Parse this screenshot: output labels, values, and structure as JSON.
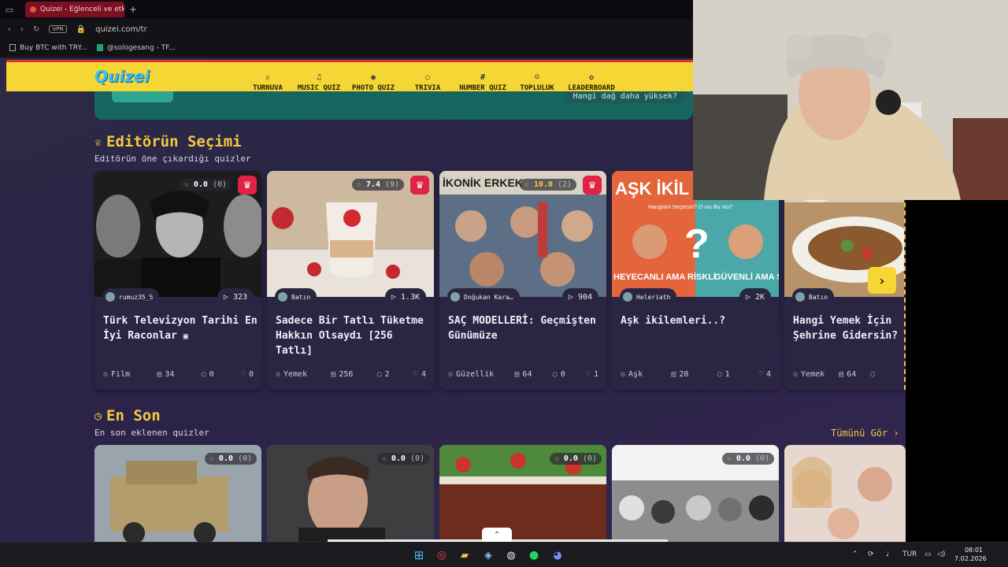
{
  "browser": {
    "tab_title": "Quizei - Eğlenceli ve etkile",
    "new_tab": "+",
    "vpn": "VPN",
    "url": "quizei.com/tr",
    "bookmarks": [
      "Buy BTC with TRY...",
      "@sologesang - TF..."
    ]
  },
  "site": {
    "logo": "Quizei",
    "nav": [
      {
        "label": "TURNUVA",
        "icon": "trophy-icon"
      },
      {
        "label": "MUSIC QUIZ",
        "icon": "music-note-icon"
      },
      {
        "label": "PHOTO QUIZ",
        "icon": "camera-icon"
      },
      {
        "label": "TRIVIA",
        "icon": "chat-icon"
      },
      {
        "label": "NUMBER QUIZ",
        "icon": "hash-icon"
      },
      {
        "label": "TOPLULUK",
        "icon": "users-icon"
      },
      {
        "label": "LEADERBOARD",
        "icon": "medal-icon"
      }
    ],
    "hero_question": "Hangi dağ daha yüksek?"
  },
  "editors_choice": {
    "title": "Editörün Seçimi",
    "subtitle": "Editörün öne çıkardığı quizler",
    "cards": [
      {
        "rating": "0.0",
        "votes": "(0)",
        "author": "rumuz35_5",
        "plays": "323",
        "title": "Türk Televizyon Tarihi En İyi Raconlar",
        "category": "Film",
        "questions": "34",
        "comments": "0",
        "likes": "0",
        "has_video": true,
        "thumb_color": "#222"
      },
      {
        "rating": "7.4",
        "votes": "(9)",
        "author": "Batın",
        "plays": "1.3K",
        "title": "Sadece Bir Tatlı Tüketme Hakkın Olsaydı [256 Tatlı]",
        "category": "Yemek",
        "questions": "256",
        "comments": "2",
        "likes": "4",
        "thumb_color": "#c9b39a"
      },
      {
        "rating": "10.0",
        "votes": "(2)",
        "author": "Doğukan Kara…",
        "plays": "904",
        "title": "SAÇ MODELLERİ: Geçmişten Günümüze",
        "category": "Güzellik",
        "questions": "64",
        "comments": "0",
        "likes": "1",
        "thumb_color": "#5b6e8a"
      },
      {
        "rating": "",
        "votes": "",
        "author": "Heleriath",
        "plays": "2K",
        "title": "Aşk ikilemleri..?",
        "category": "Aşk",
        "questions": "20",
        "comments": "1",
        "likes": "4",
        "thumb_color": "#e07a4e"
      },
      {
        "rating": "",
        "votes": "",
        "author": "Batın",
        "plays": "",
        "title": "Hangi Yemek İçin Şehrine Gidersin?",
        "category": "Yemek",
        "questions": "64",
        "comments": "",
        "likes": "",
        "thumb_color": "#c9a26a"
      }
    ],
    "thumb_text": {
      "c3_top": "İKONİK ERKEK",
      "c4_top": "AŞK İKİL",
      "c4_sub": "Hangisini Seçersin? O mu Bu mu?",
      "c4_left": "HEYECANLI AMA RİSKLİ",
      "c4_right": "GÜVENLİ AMA SAKİN"
    }
  },
  "latest": {
    "title": "En Son",
    "subtitle": "En son eklenen quizler",
    "see_all": "Tümünü Gör ›",
    "cards": [
      {
        "rating": "0.0",
        "votes": "(0)",
        "thumb_color": "#8a7a5a"
      },
      {
        "rating": "0.0",
        "votes": "(0)",
        "thumb_color": "#4a4a4a"
      },
      {
        "rating": "0.0",
        "votes": "(0)",
        "thumb_color": "#7a3a2a"
      },
      {
        "rating": "0.0",
        "votes": "(0)",
        "thumb_color": "#b8b8b8"
      },
      {
        "rating": "",
        "votes": "",
        "thumb_color": "#c99a86"
      }
    ]
  },
  "taskbar": {
    "lang": "TUR",
    "time": "08:01",
    "date": "7.02.2026"
  }
}
